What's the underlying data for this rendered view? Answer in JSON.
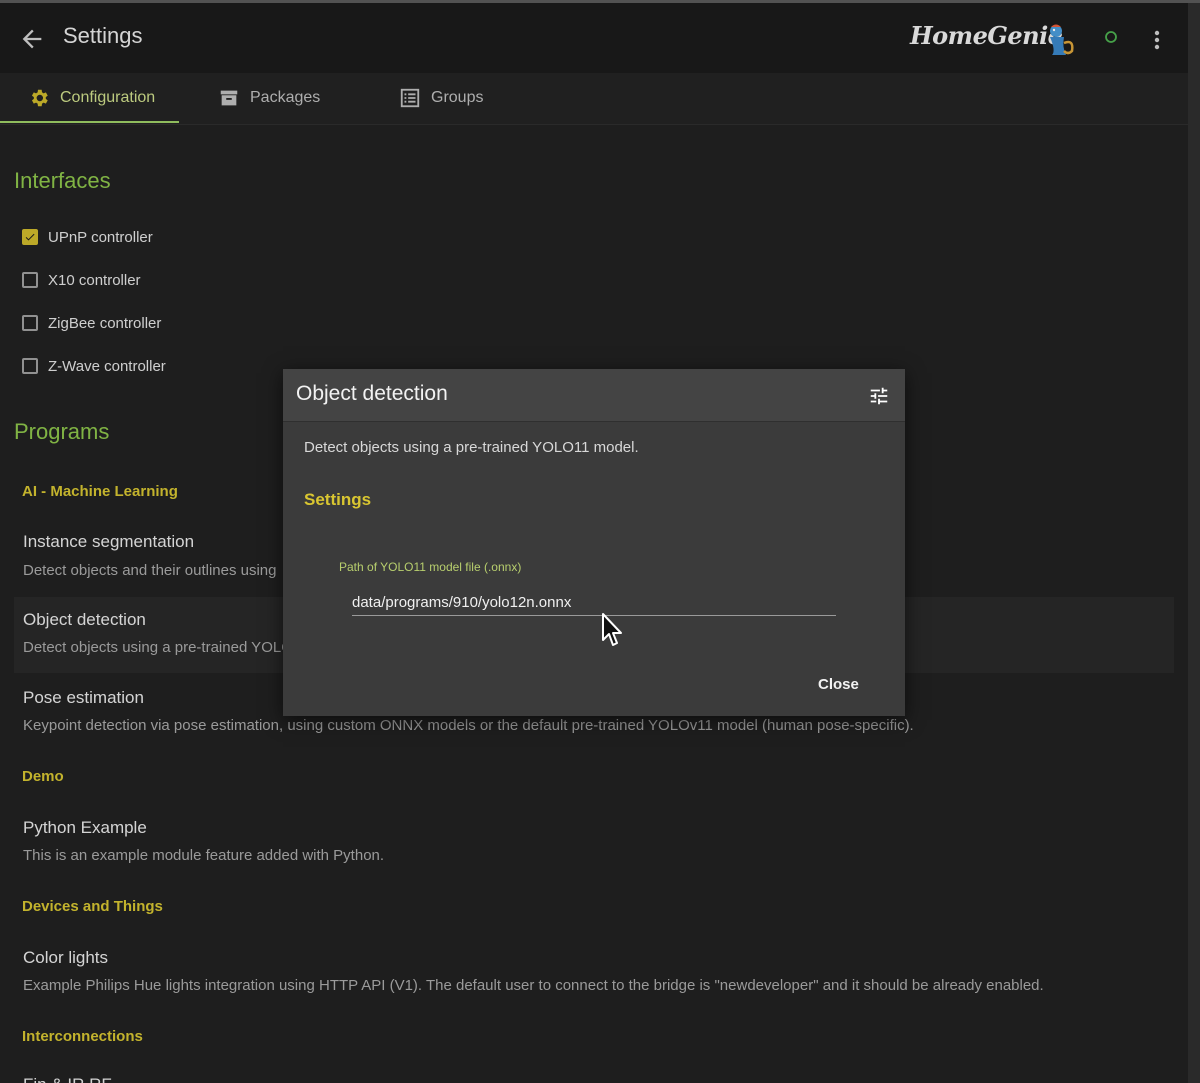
{
  "header": {
    "title": "Settings",
    "logo": "HomeGenie",
    "status_color": "#4caf50"
  },
  "tabs": [
    {
      "label": "Configuration",
      "icon": "gear-icon"
    },
    {
      "label": "Packages",
      "icon": "archive-icon"
    },
    {
      "label": "Groups",
      "icon": "list-icon"
    }
  ],
  "interfaces": {
    "title": "Interfaces",
    "items": [
      {
        "label": "UPnP controller",
        "checked": true
      },
      {
        "label": "X10 controller",
        "checked": false
      },
      {
        "label": "ZigBee controller",
        "checked": false
      },
      {
        "label": "Z-Wave controller",
        "checked": false
      }
    ]
  },
  "programs": {
    "title": "Programs",
    "categories": [
      {
        "name": "AI - Machine Learning",
        "items": [
          {
            "name": "Instance segmentation",
            "description": "Detect objects and their outlines using"
          },
          {
            "name": "Object detection",
            "description": "Detect objects using a pre-trained YOLO"
          },
          {
            "name": "Pose estimation",
            "description": "Keypoint detection via pose estimation, using custom ONNX models or the default pre-trained YOLOv11 model (human pose-specific)."
          }
        ]
      },
      {
        "name": "Demo",
        "items": [
          {
            "name": "Python Example",
            "description": "This is an example module feature added with Python."
          }
        ]
      },
      {
        "name": "Devices and Things",
        "items": [
          {
            "name": "Color lights",
            "description": "Example Philips Hue lights integration using HTTP API (V1). The default user to connect to the bridge is \"newdeveloper\" and it should be already enabled."
          }
        ]
      },
      {
        "name": "Interconnections",
        "items": [
          {
            "name": "Fin & IR RF",
            "description": ""
          }
        ]
      }
    ]
  },
  "dialog": {
    "title": "Object detection",
    "description": "Detect objects using a pre-trained YOLO11 model.",
    "section": "Settings",
    "field_label": "Path of YOLO11 model file (.onnx)",
    "field_value": "data/programs/910/yolo12n.onnx",
    "close_label": "Close"
  },
  "colors": {
    "accent_green": "#8bc34a",
    "accent_yellow": "#d4c331",
    "background": "#212121"
  }
}
